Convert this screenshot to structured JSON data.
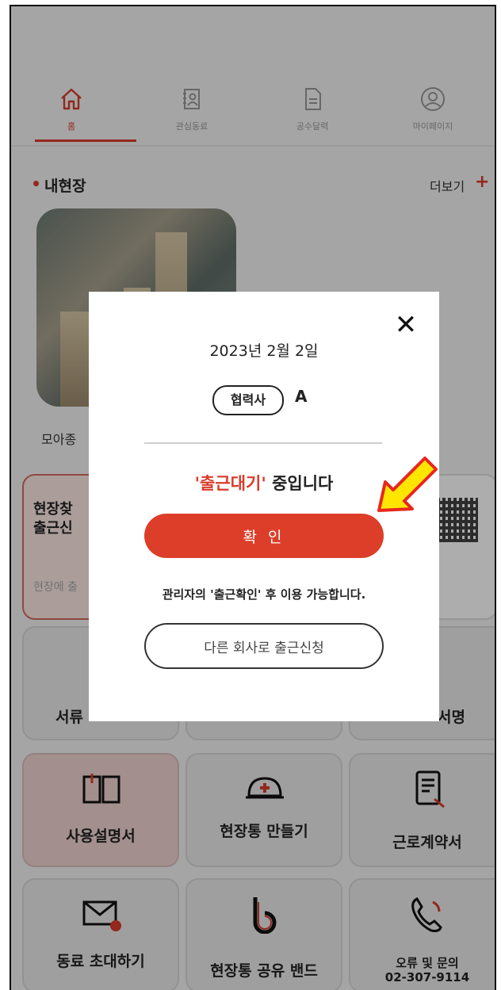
{
  "nav": {
    "items": [
      {
        "label": "홈",
        "icon": "home-icon"
      },
      {
        "label": "관심동료",
        "icon": "contact-card-icon"
      },
      {
        "label": "공수달력",
        "icon": "document-icon"
      },
      {
        "label": "마이페이지",
        "icon": "user-icon"
      }
    ],
    "active_index": 0
  },
  "section": {
    "title": "내현장",
    "more": "더보기",
    "more_plus": "+"
  },
  "site": {
    "name": "모아종"
  },
  "checkin_panel": {
    "line1": "현장찾",
    "line2": "출근신",
    "hint": "현장에 출"
  },
  "tiles": {
    "row1": [
      {
        "label": "서류"
      },
      {
        "label": ""
      },
      {
        "label": "서명"
      }
    ],
    "row2": [
      {
        "label": "사용설명서",
        "icon": "open-book-icon"
      },
      {
        "label": "현장통 만들기",
        "icon": "helmet-icon"
      },
      {
        "label": "근로계약서",
        "icon": "contract-icon"
      }
    ],
    "row3": [
      {
        "label": "동료 초대하기",
        "icon": "envelope-icon"
      },
      {
        "label": "현장통 공유 밴드",
        "icon": "band-icon"
      },
      {
        "label_1": "오류 및 문의",
        "label_2": "02-307-9114",
        "icon": "phone-icon"
      }
    ]
  },
  "modal": {
    "close": "✕",
    "date": "2023년 2월 2일",
    "partner_badge": "협력사",
    "partner_name": "A",
    "status_highlight": "'출근대기'",
    "status_rest": " 중입니다",
    "confirm_label": "확 인",
    "notice": "관리자의 '출근확인' 후 이용 가능합니다.",
    "other_label": "다른 회사로 출근신청"
  },
  "colors": {
    "accent": "#dc3e2a",
    "arrow": "#ffe600",
    "arrow_outline": "#e8281c"
  }
}
